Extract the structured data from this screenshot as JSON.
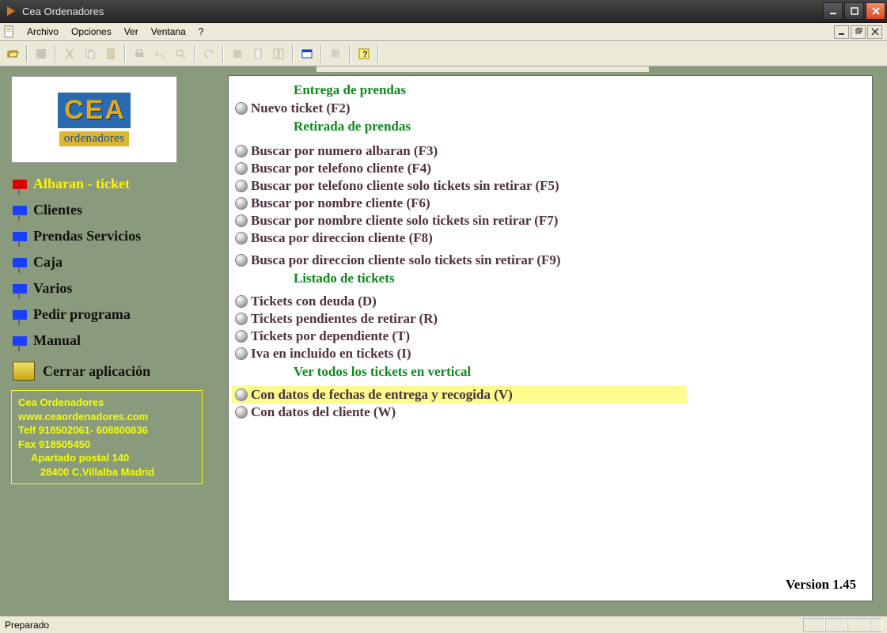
{
  "title": "Cea Ordenadores",
  "menu": {
    "archivo": "Archivo",
    "opciones": "Opciones",
    "ver": "Ver",
    "ventana": "Ventana",
    "help": "?"
  },
  "logo": {
    "top_c": "C",
    "top_e": "E",
    "top_a": "A",
    "bottom": "ordenadores"
  },
  "sidebar": {
    "items": [
      {
        "label": "Albaran - ticket"
      },
      {
        "label": "Clientes"
      },
      {
        "label": "Prendas Servicios"
      },
      {
        "label": "Caja"
      },
      {
        "label": "Varios"
      },
      {
        "label": "Pedir programa"
      },
      {
        "label": "Manual"
      }
    ],
    "exit": "Cerrar aplicación"
  },
  "contact": {
    "l1": "Cea Ordenadores",
    "l2": "www.ceaordenadores.com",
    "l3": "Telf 918502061- 608800836",
    "l4": "Fax 918505450",
    "l5": "Apartado postal 140",
    "l6": "28400 C.Villalba Madrid"
  },
  "sections": {
    "s1": "Entrega de prendas",
    "s2": "Retirada de prendas",
    "s3": "Listado de tickets",
    "s4": "Ver todos los tickets en vertical"
  },
  "links": {
    "nuevo": "Nuevo ticket (F2)",
    "num_alb": "Buscar por numero albaran (F3)",
    "tel": "Buscar por telefono cliente (F4)",
    "tel_sin": "Buscar por telefono cliente solo tickets sin retirar  (F5)",
    "nom": "Buscar por nombre cliente (F6)",
    "nom_sin": "Buscar por nombre cliente solo tickets sin retirar (F7)",
    "dir": "Busca por direccion cliente (F8)",
    "dir_sin": "Busca por direccion cliente solo tickets sin retirar (F9)",
    "deuda": "Tickets con deuda (D)",
    "pend": "Tickets  pendientes de retirar (R)",
    "dep": "Tickets  por dependiente (T)",
    "iva": "Iva en incluido en tickets (I)",
    "fechas": "Con datos de fechas de entrega y recogida (V)",
    "cliente": "Con datos del cliente (W)"
  },
  "version": "Version 1.45",
  "status": "Preparado"
}
